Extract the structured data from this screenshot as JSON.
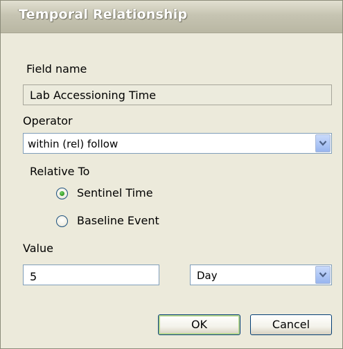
{
  "window": {
    "title": "Temporal Relationship"
  },
  "field_name": {
    "label": "Field name",
    "value": "Lab Accessioning Time"
  },
  "operator": {
    "label": "Operator",
    "selected": "within (rel) follow"
  },
  "relative_to": {
    "label": "Relative To",
    "options": [
      {
        "label": "Sentinel Time",
        "selected": true
      },
      {
        "label": "Baseline Event",
        "selected": false
      }
    ]
  },
  "value": {
    "label": "Value",
    "amount": "5",
    "unit": "Day"
  },
  "buttons": {
    "ok": "OK",
    "cancel": "Cancel"
  },
  "colors": {
    "dialog_background": "#eceadb",
    "input_border": "#7f9db9",
    "button_border": "#003c74",
    "radio_selected": "#3ea42e"
  },
  "icons": {
    "dropdown": "chevron-down-icon",
    "radio_selected": "radio-selected-icon",
    "radio_unselected": "radio-unselected-icon"
  }
}
